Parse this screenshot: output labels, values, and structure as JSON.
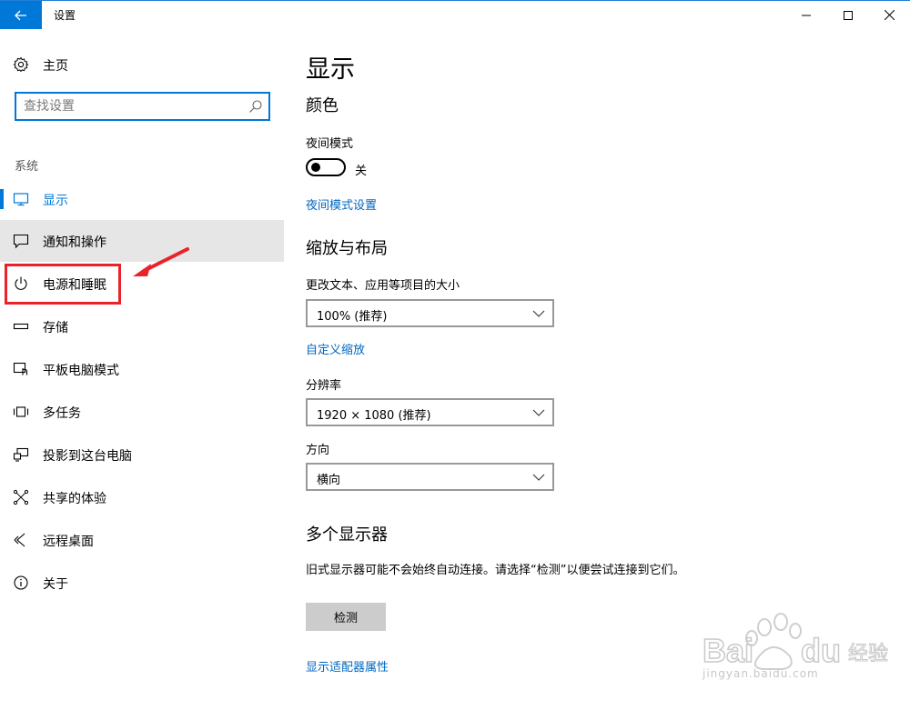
{
  "window": {
    "title": "设置",
    "back_icon": "arrow-left-icon",
    "controls": [
      "minimize-icon",
      "maximize-icon",
      "close-icon"
    ]
  },
  "sidebar": {
    "home_label": "主页",
    "search_placeholder": "查找设置",
    "section_label": "系统",
    "items": [
      {
        "label": "显示",
        "icon": "monitor-icon",
        "active": true
      },
      {
        "label": "通知和操作",
        "icon": "notification-icon"
      },
      {
        "label": "电源和睡眠",
        "icon": "power-icon"
      },
      {
        "label": "存储",
        "icon": "storage-icon"
      },
      {
        "label": "平板电脑模式",
        "icon": "tablet-mode-icon"
      },
      {
        "label": "多任务",
        "icon": "multitask-icon"
      },
      {
        "label": "投影到这台电脑",
        "icon": "project-icon"
      },
      {
        "label": "共享的体验",
        "icon": "shared-experience-icon"
      },
      {
        "label": "远程桌面",
        "icon": "remote-desktop-icon"
      },
      {
        "label": "关于",
        "icon": "info-icon"
      }
    ]
  },
  "main": {
    "title": "显示",
    "color": {
      "heading": "颜色",
      "night_mode_label": "夜间模式",
      "night_mode_state": "关",
      "night_mode_settings_link": "夜间模式设置"
    },
    "scale_layout": {
      "heading": "缩放与布局",
      "size_label": "更改文本、应用等项目的大小",
      "size_value": "100% (推荐)",
      "custom_scaling_link": "自定义缩放",
      "resolution_label": "分辨率",
      "resolution_value": "1920 × 1080 (推荐)",
      "orientation_label": "方向",
      "orientation_value": "横向"
    },
    "multi_display": {
      "heading": "多个显示器",
      "description": "旧式显示器可能不会始终自动连接。请选择“检测”以便尝试连接到它们。",
      "detect_button": "检测",
      "adapter_link": "显示适配器属性"
    }
  },
  "colors": {
    "accent": "#0078d7",
    "highlight_red": "#e8232a",
    "hover_bg": "#e6e6e6"
  },
  "watermark": {
    "url": "jingyan.baidu.com"
  }
}
